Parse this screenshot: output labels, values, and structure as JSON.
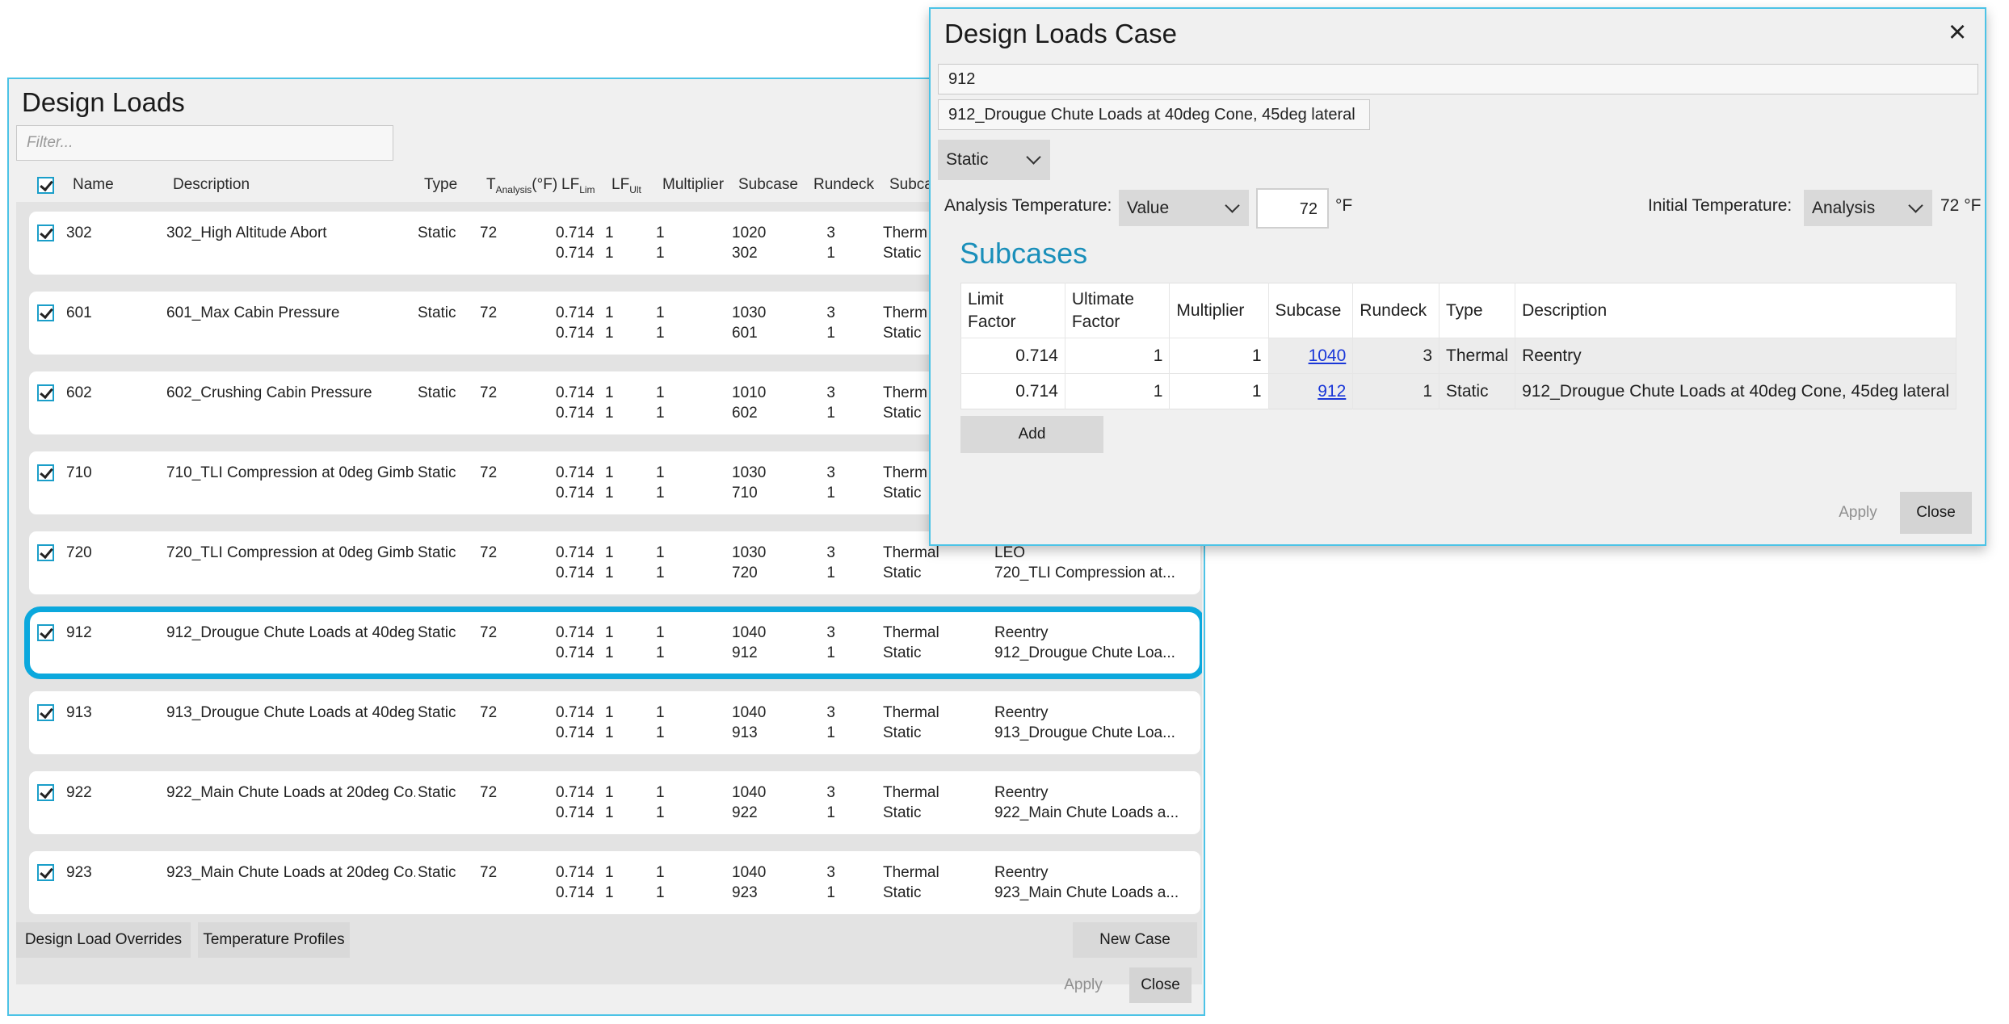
{
  "design_loads": {
    "title": "Design Loads",
    "filter_placeholder": "Filter...",
    "headers": {
      "name": "Name",
      "description": "Description",
      "type": "Type",
      "t_analysis_main": "T",
      "t_analysis_sub": "Analysis",
      "t_analysis_unit": "(°F)",
      "lf_lim_main": "LF",
      "lf_lim_sub": "Lim",
      "lf_ult_main": "LF",
      "lf_ult_sub": "Ult",
      "multiplier": "Multiplier",
      "subcase": "Subcase",
      "rundeck": "Rundeck",
      "subcase_type": "Subca"
    },
    "rows": [
      {
        "name": "302",
        "description": "302_High Altitude Abort",
        "type": "Static",
        "temp": "72",
        "subs": [
          {
            "lf_lim": "0.714",
            "lf_ult": "1",
            "mult": "1",
            "subcase": "1020",
            "rundeck": "3",
            "type": "Therm",
            "desc": ""
          },
          {
            "lf_lim": "0.714",
            "lf_ult": "1",
            "mult": "1",
            "subcase": "302",
            "rundeck": "1",
            "type": "Static",
            "desc": ""
          }
        ]
      },
      {
        "name": "601",
        "description": "601_Max Cabin Pressure",
        "type": "Static",
        "temp": "72",
        "subs": [
          {
            "lf_lim": "0.714",
            "lf_ult": "1",
            "mult": "1",
            "subcase": "1030",
            "rundeck": "3",
            "type": "Therm",
            "desc": ""
          },
          {
            "lf_lim": "0.714",
            "lf_ult": "1",
            "mult": "1",
            "subcase": "601",
            "rundeck": "1",
            "type": "Static",
            "desc": ""
          }
        ]
      },
      {
        "name": "602",
        "description": "602_Crushing Cabin Pressure",
        "type": "Static",
        "temp": "72",
        "subs": [
          {
            "lf_lim": "0.714",
            "lf_ult": "1",
            "mult": "1",
            "subcase": "1010",
            "rundeck": "3",
            "type": "Therm",
            "desc": ""
          },
          {
            "lf_lim": "0.714",
            "lf_ult": "1",
            "mult": "1",
            "subcase": "602",
            "rundeck": "1",
            "type": "Static",
            "desc": ""
          }
        ]
      },
      {
        "name": "710",
        "description": "710_TLI Compression at 0deg Gimb...",
        "type": "Static",
        "temp": "72",
        "subs": [
          {
            "lf_lim": "0.714",
            "lf_ult": "1",
            "mult": "1",
            "subcase": "1030",
            "rundeck": "3",
            "type": "Therm",
            "desc": ""
          },
          {
            "lf_lim": "0.714",
            "lf_ult": "1",
            "mult": "1",
            "subcase": "710",
            "rundeck": "1",
            "type": "Static",
            "desc": ""
          }
        ]
      },
      {
        "name": "720",
        "description": "720_TLI Compression at 0deg Gimb...",
        "type": "Static",
        "temp": "72",
        "subs": [
          {
            "lf_lim": "0.714",
            "lf_ult": "1",
            "mult": "1",
            "subcase": "1030",
            "rundeck": "3",
            "type": "Thermal",
            "desc": "LEO"
          },
          {
            "lf_lim": "0.714",
            "lf_ult": "1",
            "mult": "1",
            "subcase": "720",
            "rundeck": "1",
            "type": "Static",
            "desc": "720_TLI Compression at..."
          }
        ]
      },
      {
        "name": "912",
        "description": "912_Drougue Chute Loads at 40deg...",
        "type": "Static",
        "temp": "72",
        "subs": [
          {
            "lf_lim": "0.714",
            "lf_ult": "1",
            "mult": "1",
            "subcase": "1040",
            "rundeck": "3",
            "type": "Thermal",
            "desc": "Reentry"
          },
          {
            "lf_lim": "0.714",
            "lf_ult": "1",
            "mult": "1",
            "subcase": "912",
            "rundeck": "1",
            "type": "Static",
            "desc": "912_Drougue Chute Loa..."
          }
        ]
      },
      {
        "name": "913",
        "description": "913_Drougue Chute Loads at 40deg...",
        "type": "Static",
        "temp": "72",
        "subs": [
          {
            "lf_lim": "0.714",
            "lf_ult": "1",
            "mult": "1",
            "subcase": "1040",
            "rundeck": "3",
            "type": "Thermal",
            "desc": "Reentry"
          },
          {
            "lf_lim": "0.714",
            "lf_ult": "1",
            "mult": "1",
            "subcase": "913",
            "rundeck": "1",
            "type": "Static",
            "desc": "913_Drougue Chute Loa..."
          }
        ]
      },
      {
        "name": "922",
        "description": "922_Main Chute Loads at 20deg Co...",
        "type": "Static",
        "temp": "72",
        "subs": [
          {
            "lf_lim": "0.714",
            "lf_ult": "1",
            "mult": "1",
            "subcase": "1040",
            "rundeck": "3",
            "type": "Thermal",
            "desc": "Reentry"
          },
          {
            "lf_lim": "0.714",
            "lf_ult": "1",
            "mult": "1",
            "subcase": "922",
            "rundeck": "1",
            "type": "Static",
            "desc": "922_Main Chute Loads a..."
          }
        ]
      },
      {
        "name": "923",
        "description": "923_Main Chute Loads at 20deg Co...",
        "type": "Static",
        "temp": "72",
        "subs": [
          {
            "lf_lim": "0.714",
            "lf_ult": "1",
            "mult": "1",
            "subcase": "1040",
            "rundeck": "3",
            "type": "Thermal",
            "desc": "Reentry"
          },
          {
            "lf_lim": "0.714",
            "lf_ult": "1",
            "mult": "1",
            "subcase": "923",
            "rundeck": "1",
            "type": "Static",
            "desc": "923_Main Chute Loads a..."
          }
        ]
      }
    ],
    "selected_row": "912",
    "buttons": {
      "overrides": "Design Load Overrides",
      "temp_profiles": "Temperature Profiles",
      "new_case": "New Case",
      "apply": "Apply",
      "close": "Close"
    }
  },
  "dialog": {
    "title": "Design Loads Case",
    "close_icon": "×",
    "name_value": "912",
    "description_value": "912_Drougue Chute Loads at 40deg Cone, 45deg lateral",
    "type_value": "Static",
    "analysis_temp_label": "Analysis Temperature:",
    "analysis_temp_mode": "Value",
    "analysis_temp_value": "72",
    "analysis_temp_unit": "°F",
    "initial_temp_label": "Initial Temperature:",
    "initial_temp_mode": "Analysis",
    "initial_temp_value": "72 °F",
    "subcases_title": "Subcases",
    "columns": {
      "limit_factor_1": "Limit",
      "limit_factor_2": "Factor",
      "ultimate_factor_1": "Ultimate",
      "ultimate_factor_2": "Factor",
      "multiplier": "Multiplier",
      "subcase": "Subcase",
      "rundeck": "Rundeck",
      "type": "Type",
      "description": "Description"
    },
    "subcases": [
      {
        "limit": "0.714",
        "ultimate": "1",
        "multiplier": "1",
        "subcase": "1040",
        "rundeck": "3",
        "type": "Thermal",
        "description": "Reentry"
      },
      {
        "limit": "0.714",
        "ultimate": "1",
        "multiplier": "1",
        "subcase": "912",
        "rundeck": "1",
        "type": "Static",
        "description": "912_Drougue Chute Loads at 40deg Cone, 45deg lateral"
      }
    ],
    "add_button": "Add",
    "apply_button": "Apply",
    "close_button": "Close"
  },
  "colors": {
    "accent": "#0ba8dd",
    "link": "#1a37d8",
    "subcases_title": "#1a8fba",
    "window_border": "#4cc3e6"
  }
}
